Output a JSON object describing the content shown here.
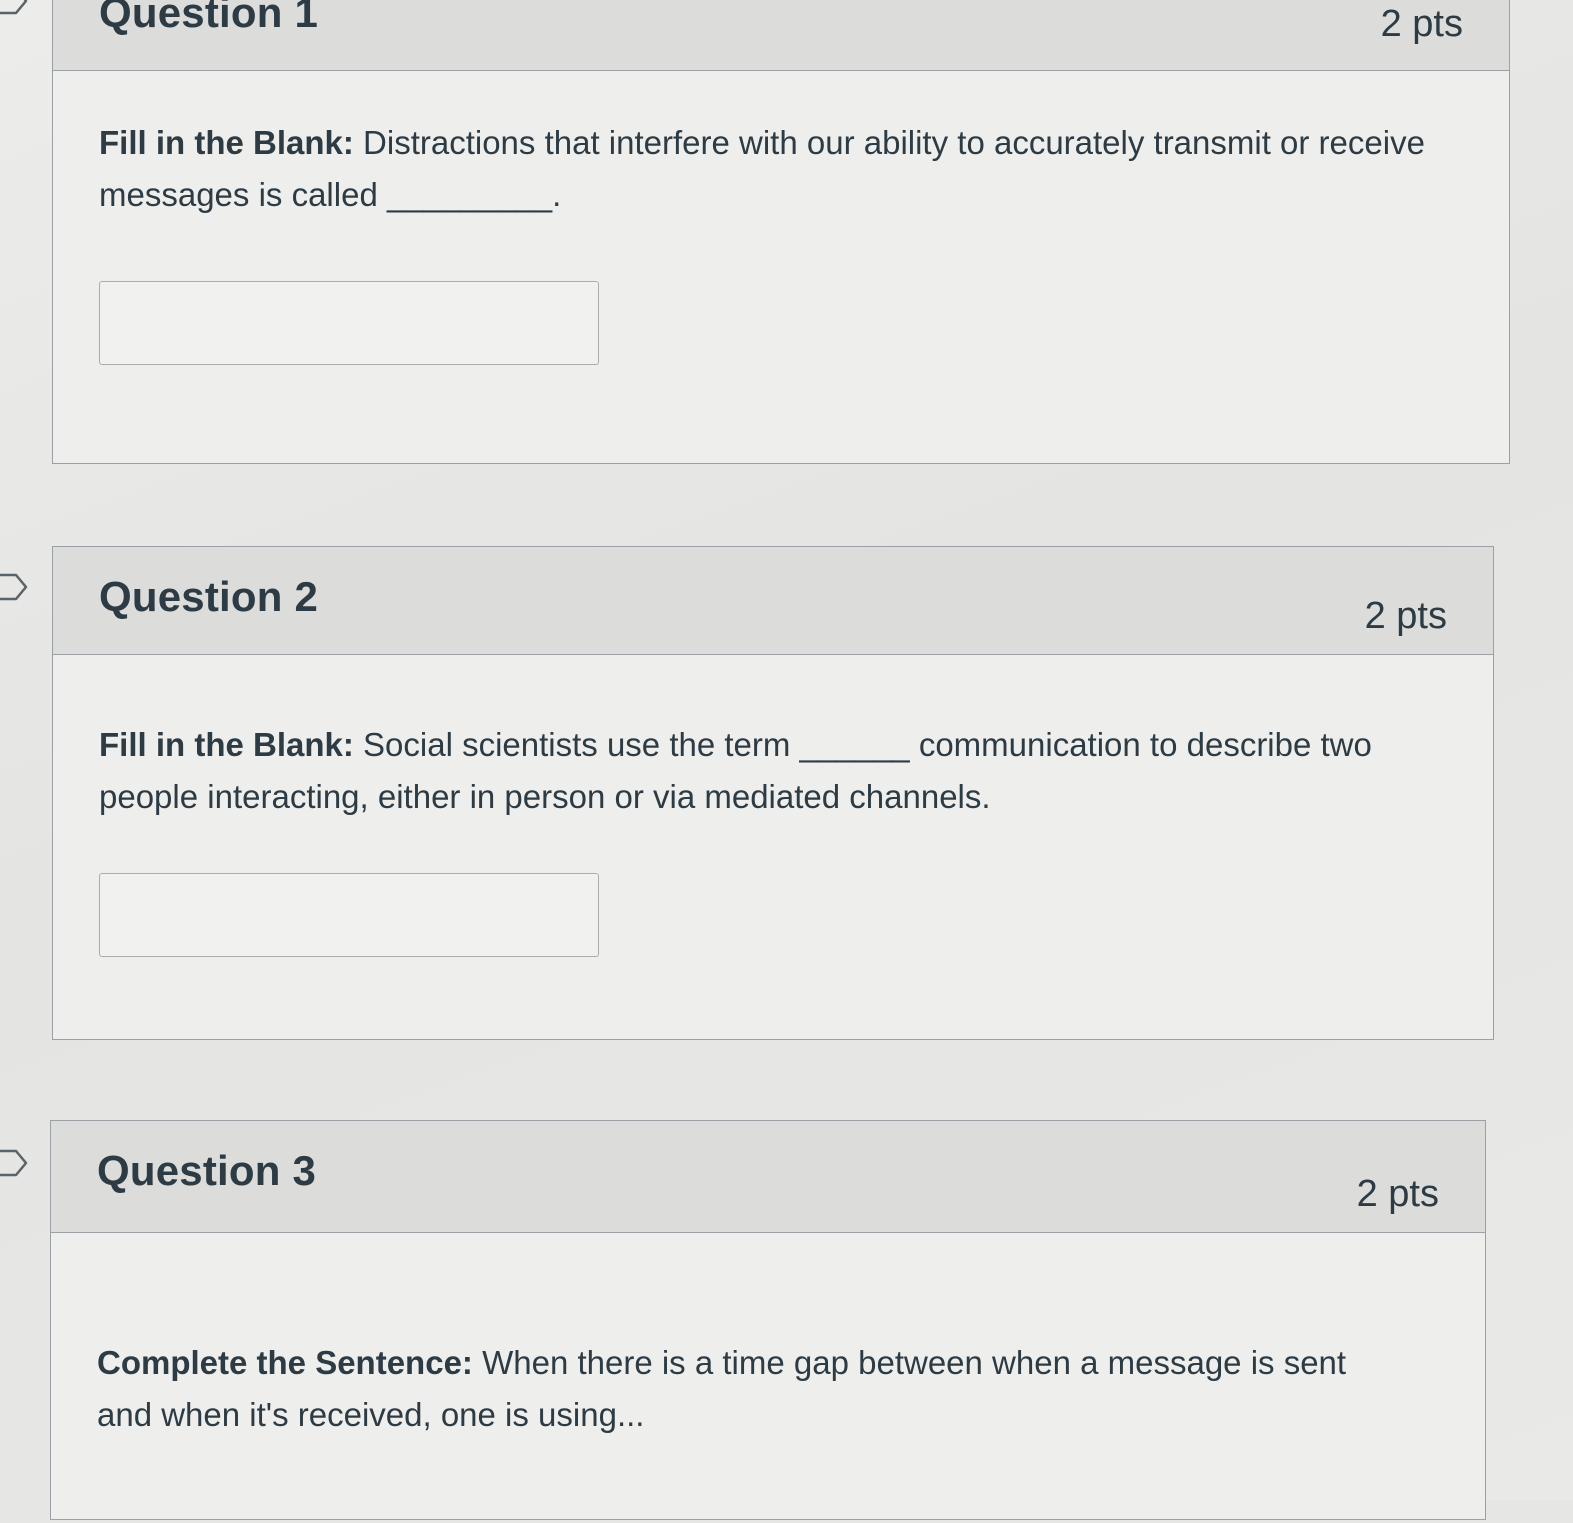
{
  "questions": [
    {
      "title": "Question 1",
      "points": "2 pts",
      "lead": "Fill in the Blank:",
      "text": " Distractions that interfere with our ability to accurately transmit or receive messages is called _________.",
      "answer_value": ""
    },
    {
      "title": "Question 2",
      "points": "2 pts",
      "lead": "Fill in the Blank:",
      "text": " Social scientists use the term ______ communication to describe two people interacting, either in person or via mediated channels.",
      "answer_value": ""
    },
    {
      "title": "Question 3",
      "points": "2 pts",
      "lead": "Complete the Sentence:",
      "text": " When there is a time gap between when a message is sent and when it's received, one is using..."
    }
  ],
  "icons": {
    "flag": "bookmark-flag-icon"
  },
  "colors": {
    "header_bg": "#dcdcdb",
    "text": "#2d3b45",
    "border": "#9aa0a3"
  }
}
